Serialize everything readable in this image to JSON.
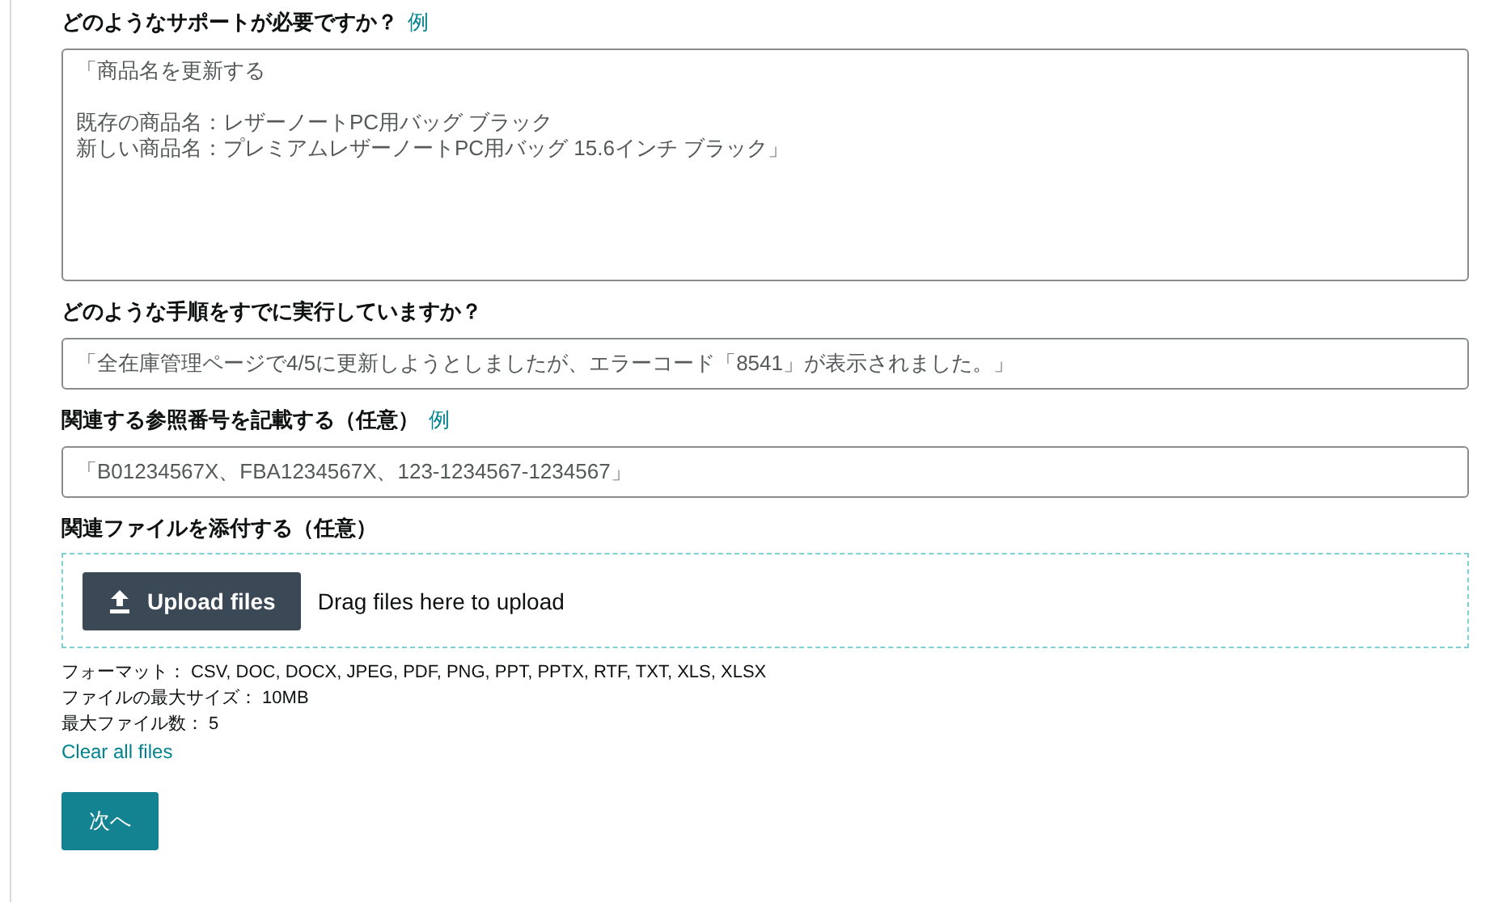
{
  "fields": [
    {
      "kind": "textarea",
      "label": "どのようなサポートが必要ですか？",
      "example_link": "例",
      "paragraphs": [
        [
          "「商品名を更新する"
        ],
        [
          "既存の商品名：レザーノートPC用バッグ ブラック",
          "新しい商品名：プレミアムレザーノートPC用バッグ 15.6インチ ブラック」"
        ]
      ]
    },
    {
      "kind": "input",
      "label": "どのような手順をすでに実行していますか？",
      "value": "「全在庫管理ページで4/5に更新しようとしましたが、エラーコード「8541」が表示されました。」"
    },
    {
      "kind": "input",
      "label": "関連する参照番号を記載する（任意）",
      "example_link": "例",
      "value": "「B01234567X、FBA1234567X、123-1234567-1234567」"
    }
  ],
  "attachments": {
    "label": "関連ファイルを添付する（任意）",
    "upload_button": "Upload files",
    "drop_hint": "Drag files here to upload",
    "constraints": [
      "フォーマット： CSV, DOC, DOCX, JPEG, PDF, PNG, PPT, PPTX, RTF, TXT, XLS, XLSX",
      "ファイルの最大サイズ： 10MB",
      "最大ファイル数： 5"
    ],
    "clear_link": "Clear all files"
  },
  "next_button": "次へ"
}
